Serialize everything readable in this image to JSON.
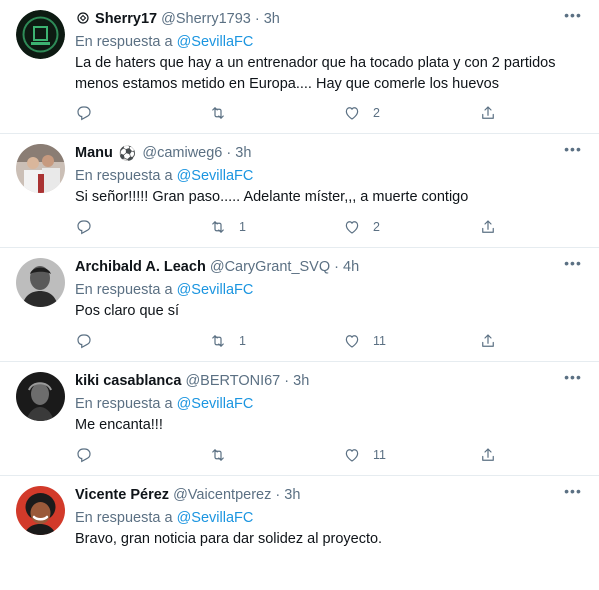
{
  "reply_prefix": "En respuesta a",
  "replying_to": "@SevillaFC",
  "more_label": "•••",
  "colors": {
    "link": "#1b95e0",
    "muted": "#5b7083",
    "text": "#0f1419",
    "divider": "#e6ecf0"
  },
  "tweets": [
    {
      "name": "Sherry17",
      "name_prefix_icon": "badge-icon",
      "handle": "@Sherry1793",
      "time": "3h",
      "text": "La de haters que hay a un entrenador que ha tocado plata y con 2 partidos menos estamos metido en Europa.... Hay que comerle los huevos",
      "replies": "",
      "retweets": "",
      "likes": "2"
    },
    {
      "name": "Manu",
      "name_suffix_icon": "soccer-ball-icon",
      "name_suffix_glyph": "⚽",
      "handle": "@camiweg6",
      "time": "3h",
      "text": "Si señor!!!!! Gran paso..... Adelante míster,,, a muerte contigo",
      "replies": "",
      "retweets": "1",
      "likes": "2"
    },
    {
      "name": "Archibald A. Leach",
      "handle": "@CaryGrant_SVQ",
      "time": "4h",
      "text": "Pos claro que sí",
      "replies": "",
      "retweets": "1",
      "likes": "11"
    },
    {
      "name": "kiki casablanca",
      "handle": "@BERTONI67",
      "time": "3h",
      "text": "Me encanta!!!",
      "replies": "",
      "retweets": "",
      "likes": "11"
    },
    {
      "name": "Vicente Pérez",
      "handle": "@Vaicentperez",
      "time": "3h",
      "text": "Bravo, gran noticia para dar solidez al proyecto.",
      "replies": "",
      "retweets": "",
      "likes": ""
    }
  ]
}
